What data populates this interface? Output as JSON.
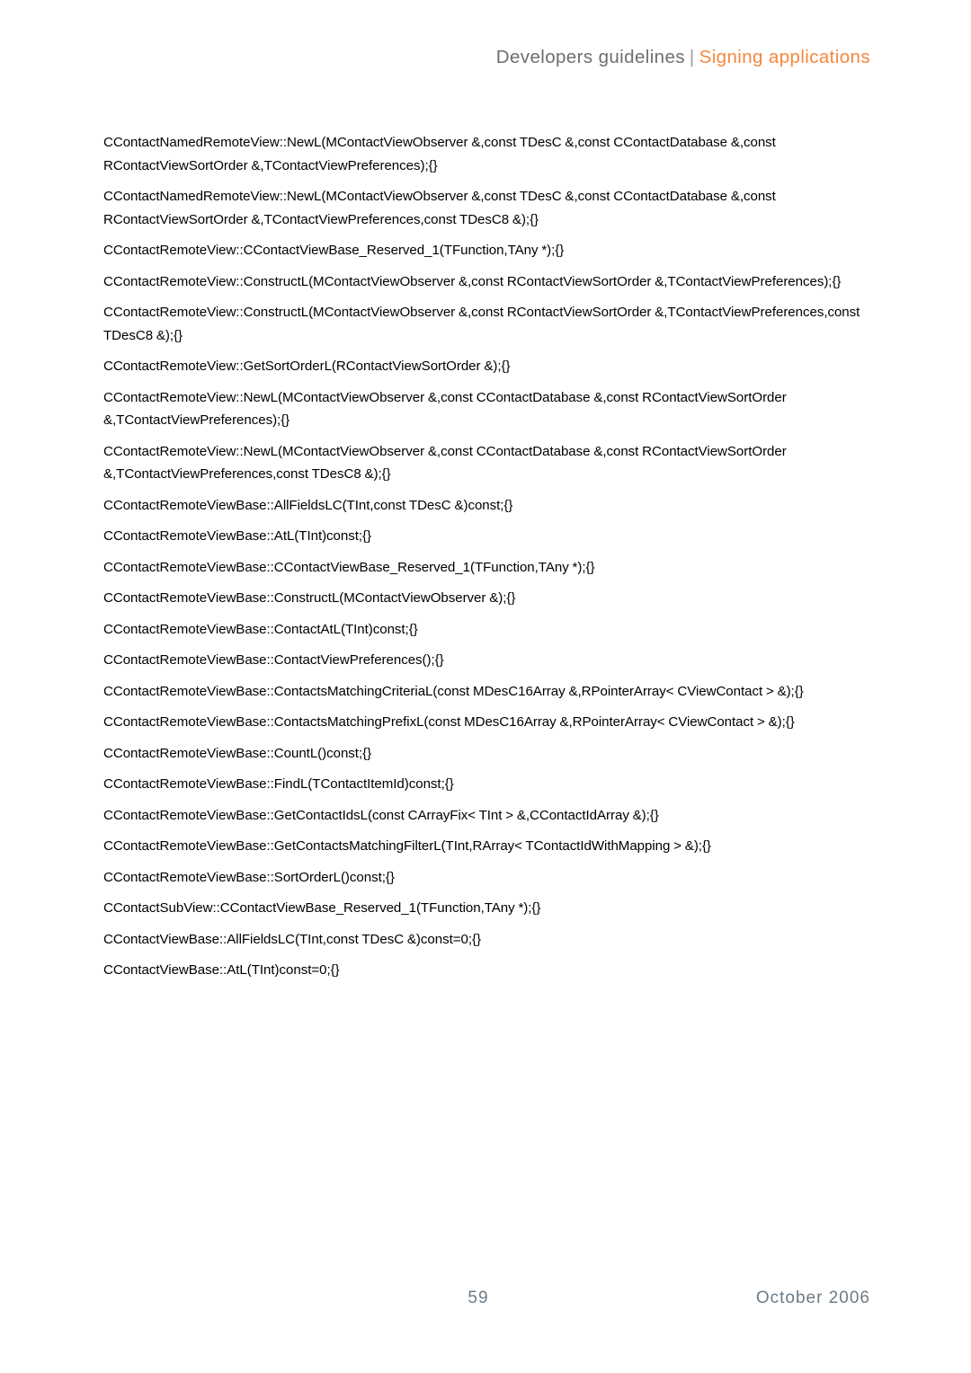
{
  "header": {
    "primary": "Developers guidelines",
    "separator": "|",
    "accent": "Signing applications",
    "accent_color": "#f5873c",
    "primary_color": "#6d6e71"
  },
  "footer": {
    "page_number": "59",
    "date": "October 2006",
    "text_color": "#6d7b86"
  },
  "body": {
    "entries": [
      "CContactNamedRemoteView::NewL(MContactViewObserver &,const TDesC &,const CContactDatabase &,const RContactViewSortOrder &,TContactViewPreferences);{}",
      "CContactNamedRemoteView::NewL(MContactViewObserver &,const TDesC &,const CContactDatabase &,const RContactViewSortOrder &,TContactViewPreferences,const TDesC8 &);{}",
      "CContactRemoteView::CContactViewBase_Reserved_1(TFunction,TAny *);{}",
      "CContactRemoteView::ConstructL(MContactViewObserver &,const RContactViewSortOrder &,TContactViewPreferences);{}",
      "CContactRemoteView::ConstructL(MContactViewObserver &,const RContactViewSortOrder &,TContactViewPreferences,const TDesC8 &);{}",
      "CContactRemoteView::GetSortOrderL(RContactViewSortOrder &);{}",
      "CContactRemoteView::NewL(MContactViewObserver &,const CContactDatabase &,const RContactViewSortOrder &,TContactViewPreferences);{}",
      "CContactRemoteView::NewL(MContactViewObserver &,const CContactDatabase &,const RContactViewSortOrder &,TContactViewPreferences,const TDesC8 &);{}",
      "CContactRemoteViewBase::AllFieldsLC(TInt,const TDesC &)const;{}",
      "CContactRemoteViewBase::AtL(TInt)const;{}",
      "CContactRemoteViewBase::CContactViewBase_Reserved_1(TFunction,TAny *);{}",
      "CContactRemoteViewBase::ConstructL(MContactViewObserver &);{}",
      "CContactRemoteViewBase::ContactAtL(TInt)const;{}",
      "CContactRemoteViewBase::ContactViewPreferences();{}",
      "CContactRemoteViewBase::ContactsMatchingCriteriaL(const MDesC16Array &,RPointerArray< CViewContact > &);{}",
      "CContactRemoteViewBase::ContactsMatchingPrefixL(const MDesC16Array &,RPointerArray< CViewContact > &);{}",
      "CContactRemoteViewBase::CountL()const;{}",
      "CContactRemoteViewBase::FindL(TContactItemId)const;{}",
      "CContactRemoteViewBase::GetContactIdsL(const CArrayFix< TInt > &,CContactIdArray &);{}",
      "CContactRemoteViewBase::GetContactsMatchingFilterL(TInt,RArray< TContactIdWithMapping > &);{}",
      "CContactRemoteViewBase::SortOrderL()const;{}",
      "CContactSubView::CContactViewBase_Reserved_1(TFunction,TAny *);{}",
      "CContactViewBase::AllFieldsLC(TInt,const TDesC &)const=0;{}",
      "CContactViewBase::AtL(TInt)const=0;{}"
    ]
  }
}
